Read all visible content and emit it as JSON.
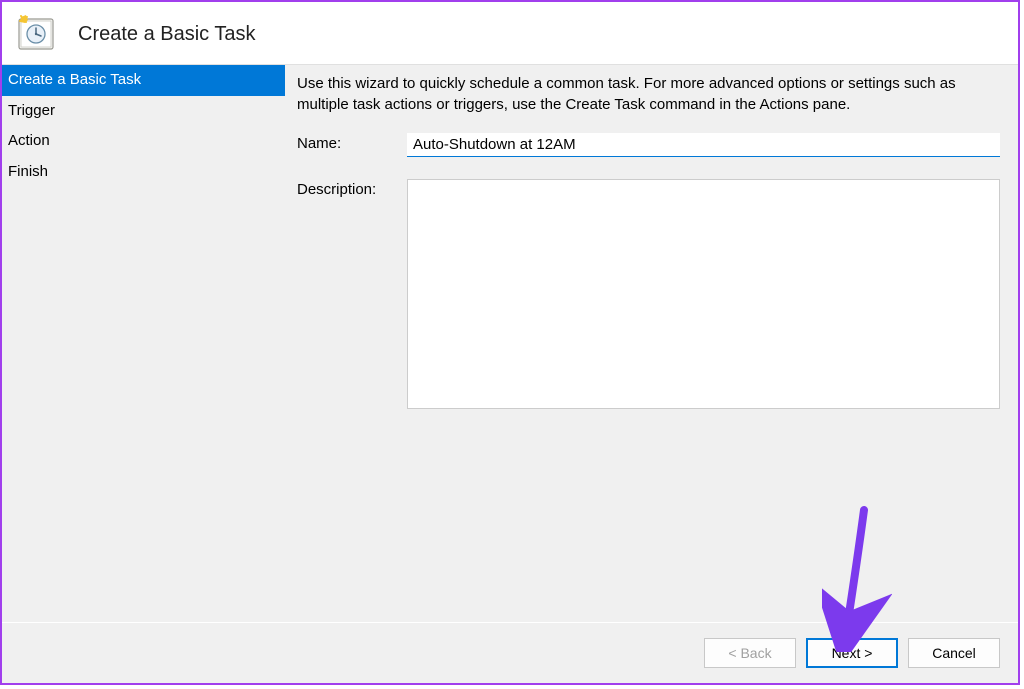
{
  "header": {
    "title": "Create a Basic Task"
  },
  "sidebar": {
    "items": [
      {
        "label": "Create a Basic Task",
        "selected": true
      },
      {
        "label": "Trigger",
        "selected": false
      },
      {
        "label": "Action",
        "selected": false
      },
      {
        "label": "Finish",
        "selected": false
      }
    ]
  },
  "main": {
    "instructions": "Use this wizard to quickly schedule a common task.  For more advanced options or settings such as multiple task actions or triggers, use the Create Task command in the Actions pane.",
    "name_label": "Name:",
    "name_value": "Auto-Shutdown at 12AM",
    "description_label": "Description:",
    "description_value": ""
  },
  "footer": {
    "back_label": "< Back",
    "next_label": "Next >",
    "cancel_label": "Cancel"
  },
  "colors": {
    "selection": "#0078d7",
    "annotation": "#7c3aed"
  }
}
